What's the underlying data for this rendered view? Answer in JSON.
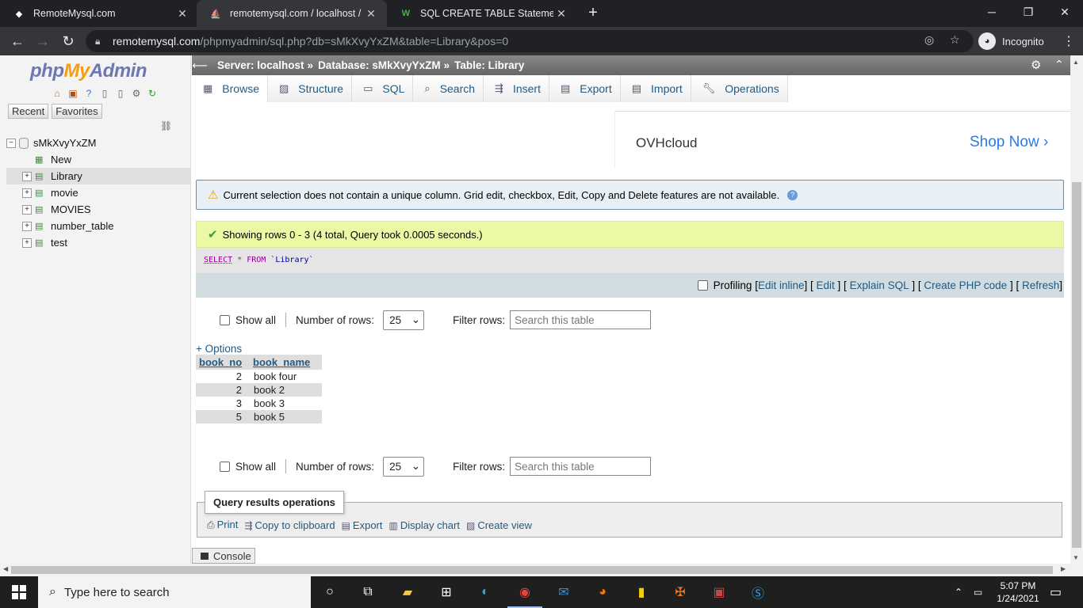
{
  "browser": {
    "tabs": [
      {
        "title": "RemoteMysql.com",
        "active": false
      },
      {
        "title": "remotemysql.com / localhost / sM",
        "active": true
      },
      {
        "title": "SQL CREATE TABLE Statement",
        "active": false
      }
    ],
    "url_host": "remotemysql.com",
    "url_path": "/phpmyadmin/sql.php?db=sMkXvyYxZM&table=Library&pos=0",
    "incognito_label": "Incognito"
  },
  "nav": {
    "logo_php": "php",
    "logo_my": "My",
    "logo_admin": "Admin",
    "recent": "Recent",
    "favorites": "Favorites",
    "database": "sMkXvyYxZM",
    "items": [
      {
        "label": "New"
      },
      {
        "label": "Library"
      },
      {
        "label": "movie"
      },
      {
        "label": "MOVIES"
      },
      {
        "label": "number_table"
      },
      {
        "label": "test"
      }
    ]
  },
  "breadcrumb": {
    "server": "Server: localhost",
    "database": "Database: sMkXvyYxZM",
    "table": "Table: Library",
    "sep": "»"
  },
  "tabs": [
    "Browse",
    "Structure",
    "SQL",
    "Search",
    "Insert",
    "Export",
    "Import",
    "Operations"
  ],
  "ad": {
    "brand": "OVHcloud",
    "cta": "Shop Now"
  },
  "notice": "Current selection does not contain a unique column. Grid edit, checkbox, Edit, Copy and Delete features are not available.",
  "success": "Showing rows 0 - 3 (4 total, Query took 0.0005 seconds.)",
  "sql": {
    "select": "SELECT",
    "star": "*",
    "from": "FROM",
    "table": "`Library`"
  },
  "sql_options": {
    "profiling": "Profiling",
    "edit_inline": "Edit inline",
    "edit": "Edit",
    "explain": "Explain SQL",
    "create_php": "Create PHP code",
    "refresh": "Refresh"
  },
  "pager": {
    "show_all": "Show all",
    "number_of_rows": "Number of rows:",
    "rows_value": "25",
    "filter_rows": "Filter rows:",
    "filter_placeholder": "Search this table"
  },
  "options_link": "+ Options",
  "table": {
    "columns": [
      "book_no",
      "book_name"
    ],
    "rows": [
      [
        "2",
        "book four"
      ],
      [
        "2",
        "book 2"
      ],
      [
        "3",
        "book 3"
      ],
      [
        "5",
        "book 5"
      ]
    ]
  },
  "query_ops": {
    "title": "Query results operations",
    "print": "Print",
    "copy": "Copy to clipboard",
    "export": "Export",
    "chart": "Display chart",
    "view": "Create view"
  },
  "console": "Console",
  "taskbar": {
    "search_placeholder": "Type here to search",
    "time": "5:07 PM",
    "date": "1/24/2021"
  }
}
